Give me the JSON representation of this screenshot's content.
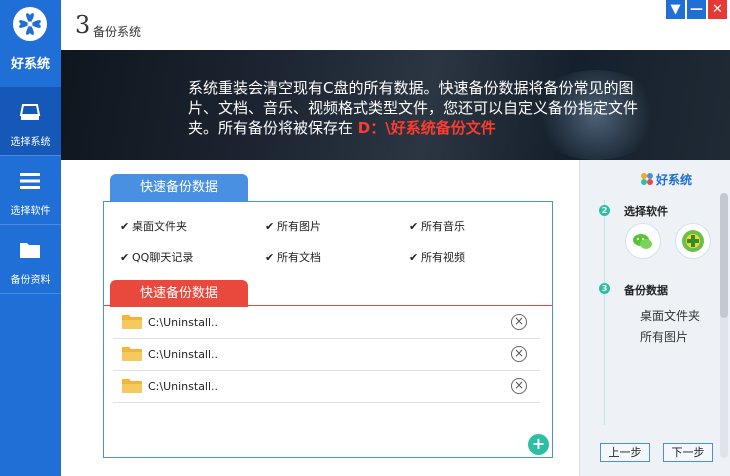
{
  "app": {
    "logo_text": "好系统"
  },
  "sidebar": {
    "items": [
      {
        "label": "选择系统",
        "icon": "system-icon",
        "active": true
      },
      {
        "label": "选择软件",
        "icon": "list-icon",
        "active": false
      },
      {
        "label": "备份资料",
        "icon": "folder-icon",
        "active": false
      }
    ]
  },
  "header": {
    "step_number": "3",
    "title": "备份系统"
  },
  "window": {
    "menu_glyph": "▼",
    "min_glyph": "—",
    "close_glyph": "✕"
  },
  "banner": {
    "text": "系统重装会清空现有C盘的所有数据。快速备份数据将备份常见的图片、文档、音乐、视频格式类型文件，您还可以自定义备份指定文件夹。所有备份将被保存在",
    "highlight": "D：\\好系统备份文件"
  },
  "quick_backup": {
    "tab_label": "快速备份数据",
    "options": [
      {
        "label": "桌面文件夹",
        "checked": true
      },
      {
        "label": "所有图片",
        "checked": true
      },
      {
        "label": "所有音乐",
        "checked": true
      },
      {
        "label": "QQ聊天记录",
        "checked": true
      },
      {
        "label": "所有文档",
        "checked": true
      },
      {
        "label": "所有视频",
        "checked": true
      }
    ]
  },
  "custom_backup": {
    "tab_label": "快速备份数据",
    "folders": [
      {
        "path": "C:\\Uninstall.."
      },
      {
        "path": "C:\\Uninstall.."
      },
      {
        "path": "C:\\Uninstall.."
      }
    ],
    "add_glyph": "+"
  },
  "right_panel": {
    "logo_text": "好系统",
    "steps": [
      {
        "number": "2",
        "title": "选择软件"
      },
      {
        "number": "3",
        "title": "备份数据"
      }
    ],
    "apps": [
      "wechat-icon",
      "360-icon"
    ],
    "backup_files": [
      "桌面文件夹",
      "所有图片"
    ],
    "prev_label": "上一步",
    "next_label": "下一步"
  },
  "colors": {
    "primary": "#1f6fd6",
    "accent_red": "#e9493d",
    "accent_teal": "#2cbfa5"
  }
}
